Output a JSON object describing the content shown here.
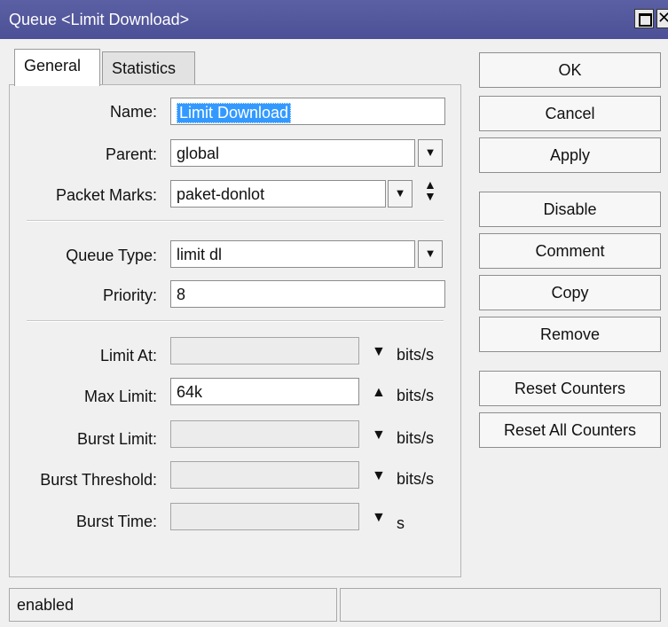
{
  "window": {
    "title": "Queue <Limit Download>"
  },
  "tabs": [
    {
      "label": "General"
    },
    {
      "label": "Statistics"
    }
  ],
  "form": {
    "name": {
      "label": "Name:",
      "value": "Limit Download"
    },
    "parent": {
      "label": "Parent:",
      "value": "global"
    },
    "packet_marks": {
      "label": "Packet Marks:",
      "value": "paket-donlot"
    },
    "queue_type": {
      "label": "Queue Type:",
      "value": "limit dl"
    },
    "priority": {
      "label": "Priority:",
      "value": "8"
    },
    "limit_at": {
      "label": "Limit At:",
      "value": "",
      "unit": "bits/s",
      "arrow": "▼"
    },
    "max_limit": {
      "label": "Max Limit:",
      "value": "64k",
      "unit": "bits/s",
      "arrow": "▲"
    },
    "burst_limit": {
      "label": "Burst Limit:",
      "value": "",
      "unit": "bits/s",
      "arrow": "▼"
    },
    "burst_threshold": {
      "label": "Burst Threshold:",
      "value": "",
      "unit": "bits/s",
      "arrow": "▼"
    },
    "burst_time": {
      "label": "Burst Time:",
      "value": "",
      "unit": "s",
      "arrow": "▼"
    }
  },
  "buttons": {
    "ok": "OK",
    "cancel": "Cancel",
    "apply": "Apply",
    "disable": "Disable",
    "comment": "Comment",
    "copy": "Copy",
    "remove": "Remove",
    "reset_counters": "Reset Counters",
    "reset_all_counters": "Reset All Counters"
  },
  "icons": {
    "dropdown": "dropdown-arrow-icon",
    "updown": "up-down-arrows-icon",
    "close": "close-icon",
    "maximize": "maximize-icon"
  },
  "status": {
    "left": "enabled",
    "right": ""
  },
  "colors": {
    "titlebar": "#4c5096",
    "selection": "#3399ff"
  }
}
